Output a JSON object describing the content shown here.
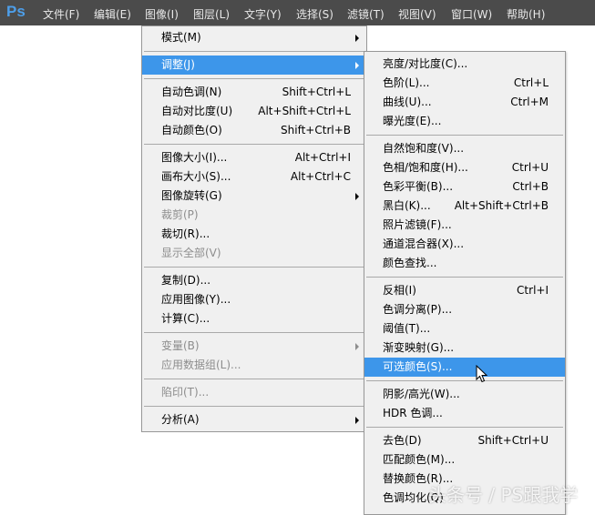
{
  "app": {
    "logo": "Ps"
  },
  "menubar": [
    "文件(F)",
    "编辑(E)",
    "图像(I)",
    "图层(L)",
    "文字(Y)",
    "选择(S)",
    "滤镜(T)",
    "视图(V)",
    "窗口(W)",
    "帮助(H)"
  ],
  "image_menu": [
    {
      "label": "模式(M)",
      "submenu": true
    },
    {
      "sep": true
    },
    {
      "label": "调整(J)",
      "submenu": true,
      "highlighted": true
    },
    {
      "sep": true
    },
    {
      "label": "自动色调(N)",
      "shortcut": "Shift+Ctrl+L"
    },
    {
      "label": "自动对比度(U)",
      "shortcut": "Alt+Shift+Ctrl+L"
    },
    {
      "label": "自动颜色(O)",
      "shortcut": "Shift+Ctrl+B"
    },
    {
      "sep": true
    },
    {
      "label": "图像大小(I)...",
      "shortcut": "Alt+Ctrl+I"
    },
    {
      "label": "画布大小(S)...",
      "shortcut": "Alt+Ctrl+C"
    },
    {
      "label": "图像旋转(G)",
      "submenu": true
    },
    {
      "label": "裁剪(P)",
      "disabled": true
    },
    {
      "label": "裁切(R)..."
    },
    {
      "label": "显示全部(V)",
      "disabled": true
    },
    {
      "sep": true
    },
    {
      "label": "复制(D)..."
    },
    {
      "label": "应用图像(Y)..."
    },
    {
      "label": "计算(C)..."
    },
    {
      "sep": true
    },
    {
      "label": "变量(B)",
      "submenu": true,
      "disabled": true
    },
    {
      "label": "应用数据组(L)...",
      "disabled": true
    },
    {
      "sep": true
    },
    {
      "label": "陷印(T)...",
      "disabled": true
    },
    {
      "sep": true
    },
    {
      "label": "分析(A)",
      "submenu": true
    }
  ],
  "adjust_menu": [
    {
      "label": "亮度/对比度(C)..."
    },
    {
      "label": "色阶(L)...",
      "shortcut": "Ctrl+L"
    },
    {
      "label": "曲线(U)...",
      "shortcut": "Ctrl+M"
    },
    {
      "label": "曝光度(E)..."
    },
    {
      "sep": true
    },
    {
      "label": "自然饱和度(V)..."
    },
    {
      "label": "色相/饱和度(H)...",
      "shortcut": "Ctrl+U"
    },
    {
      "label": "色彩平衡(B)...",
      "shortcut": "Ctrl+B"
    },
    {
      "label": "黑白(K)...",
      "shortcut": "Alt+Shift+Ctrl+B"
    },
    {
      "label": "照片滤镜(F)..."
    },
    {
      "label": "通道混合器(X)..."
    },
    {
      "label": "颜色查找..."
    },
    {
      "sep": true
    },
    {
      "label": "反相(I)",
      "shortcut": "Ctrl+I"
    },
    {
      "label": "色调分离(P)..."
    },
    {
      "label": "阈值(T)..."
    },
    {
      "label": "渐变映射(G)..."
    },
    {
      "label": "可选颜色(S)...",
      "highlighted": true
    },
    {
      "sep": true
    },
    {
      "label": "阴影/高光(W)..."
    },
    {
      "label": "HDR 色调..."
    },
    {
      "sep": true
    },
    {
      "label": "去色(D)",
      "shortcut": "Shift+Ctrl+U"
    },
    {
      "label": "匹配颜色(M)..."
    },
    {
      "label": "替换颜色(R)..."
    },
    {
      "label": "色调均化(Q)"
    }
  ],
  "watermark": "头条号 / PS跟我学",
  "colors": {
    "menubar": "#4b4b4b",
    "highlight": "#3d96ea",
    "menu_bg": "#f0f0f0"
  }
}
